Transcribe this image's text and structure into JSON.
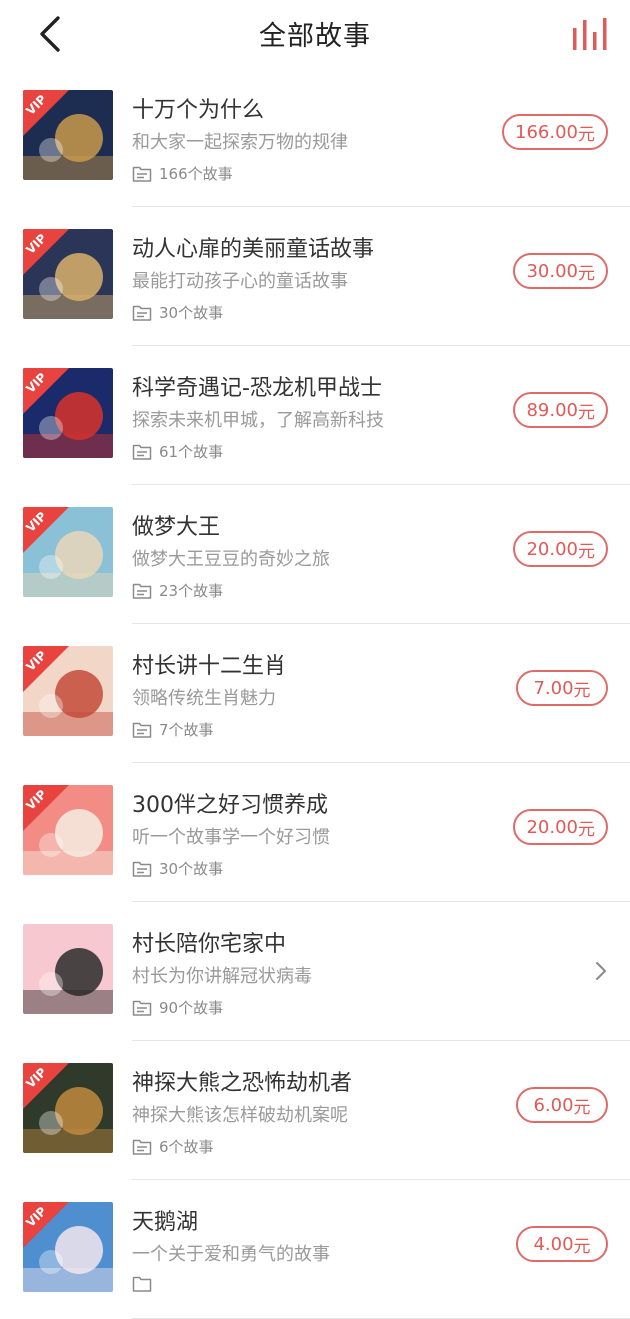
{
  "header": {
    "title": "全部故事",
    "back_icon": "back-arrow-icon",
    "stats_icon": "bar-chart-icon",
    "accent": "#e05a58"
  },
  "vip_label": "VIP",
  "currency_suffix": "元",
  "stories": [
    {
      "title": "十万个为什么",
      "subtitle": "和大家一起探索万物的规律",
      "count": "166个故事",
      "price": "166.00",
      "vip": true,
      "cover_colors": [
        "#1d2d52",
        "#c99a4a"
      ]
    },
    {
      "title": "动人心扉的美丽童话故事",
      "subtitle": "最能打动孩子心的童话故事",
      "count": "30个故事",
      "price": "30.00",
      "vip": true,
      "cover_colors": [
        "#2a3558",
        "#d9b06a"
      ]
    },
    {
      "title": "科学奇遇记-恐龙机甲战士",
      "subtitle": "探索未来机甲城，了解高新科技",
      "count": "61个故事",
      "price": "89.00",
      "vip": true,
      "cover_colors": [
        "#1a2a6a",
        "#d8322a"
      ]
    },
    {
      "title": "做梦大王",
      "subtitle": "做梦大王豆豆的奇妙之旅",
      "count": "23个故事",
      "price": "20.00",
      "vip": true,
      "cover_colors": [
        "#8bc1d6",
        "#e9d6b8"
      ]
    },
    {
      "title": "村长讲十二生肖",
      "subtitle": "领略传统生肖魅力",
      "count": "7个故事",
      "price": "7.00",
      "vip": true,
      "cover_colors": [
        "#f2d6c8",
        "#c44b3a"
      ]
    },
    {
      "title": "300伴之好习惯养成",
      "subtitle": "听一个故事学一个好习惯",
      "count": "30个故事",
      "price": "20.00",
      "vip": true,
      "cover_colors": [
        "#f28c84",
        "#f6ece2"
      ]
    },
    {
      "title": "村长陪你宅家中",
      "subtitle": "村长为你讲解冠状病毒",
      "count": "90个故事",
      "price": "",
      "vip": false,
      "cover_colors": [
        "#f7c8cf",
        "#2b2b2b"
      ]
    },
    {
      "title": "神探大熊之恐怖劫机者",
      "subtitle": "神探大熊该怎样破劫机案呢",
      "count": "6个故事",
      "price": "6.00",
      "vip": true,
      "cover_colors": [
        "#2f3a2a",
        "#c08a3e"
      ]
    },
    {
      "title": "天鹅湖",
      "subtitle": "一个关于爱和勇气的故事",
      "count": "",
      "price": "4.00",
      "vip": true,
      "cover_colors": [
        "#4f8fd0",
        "#f2e6ee"
      ]
    }
  ]
}
